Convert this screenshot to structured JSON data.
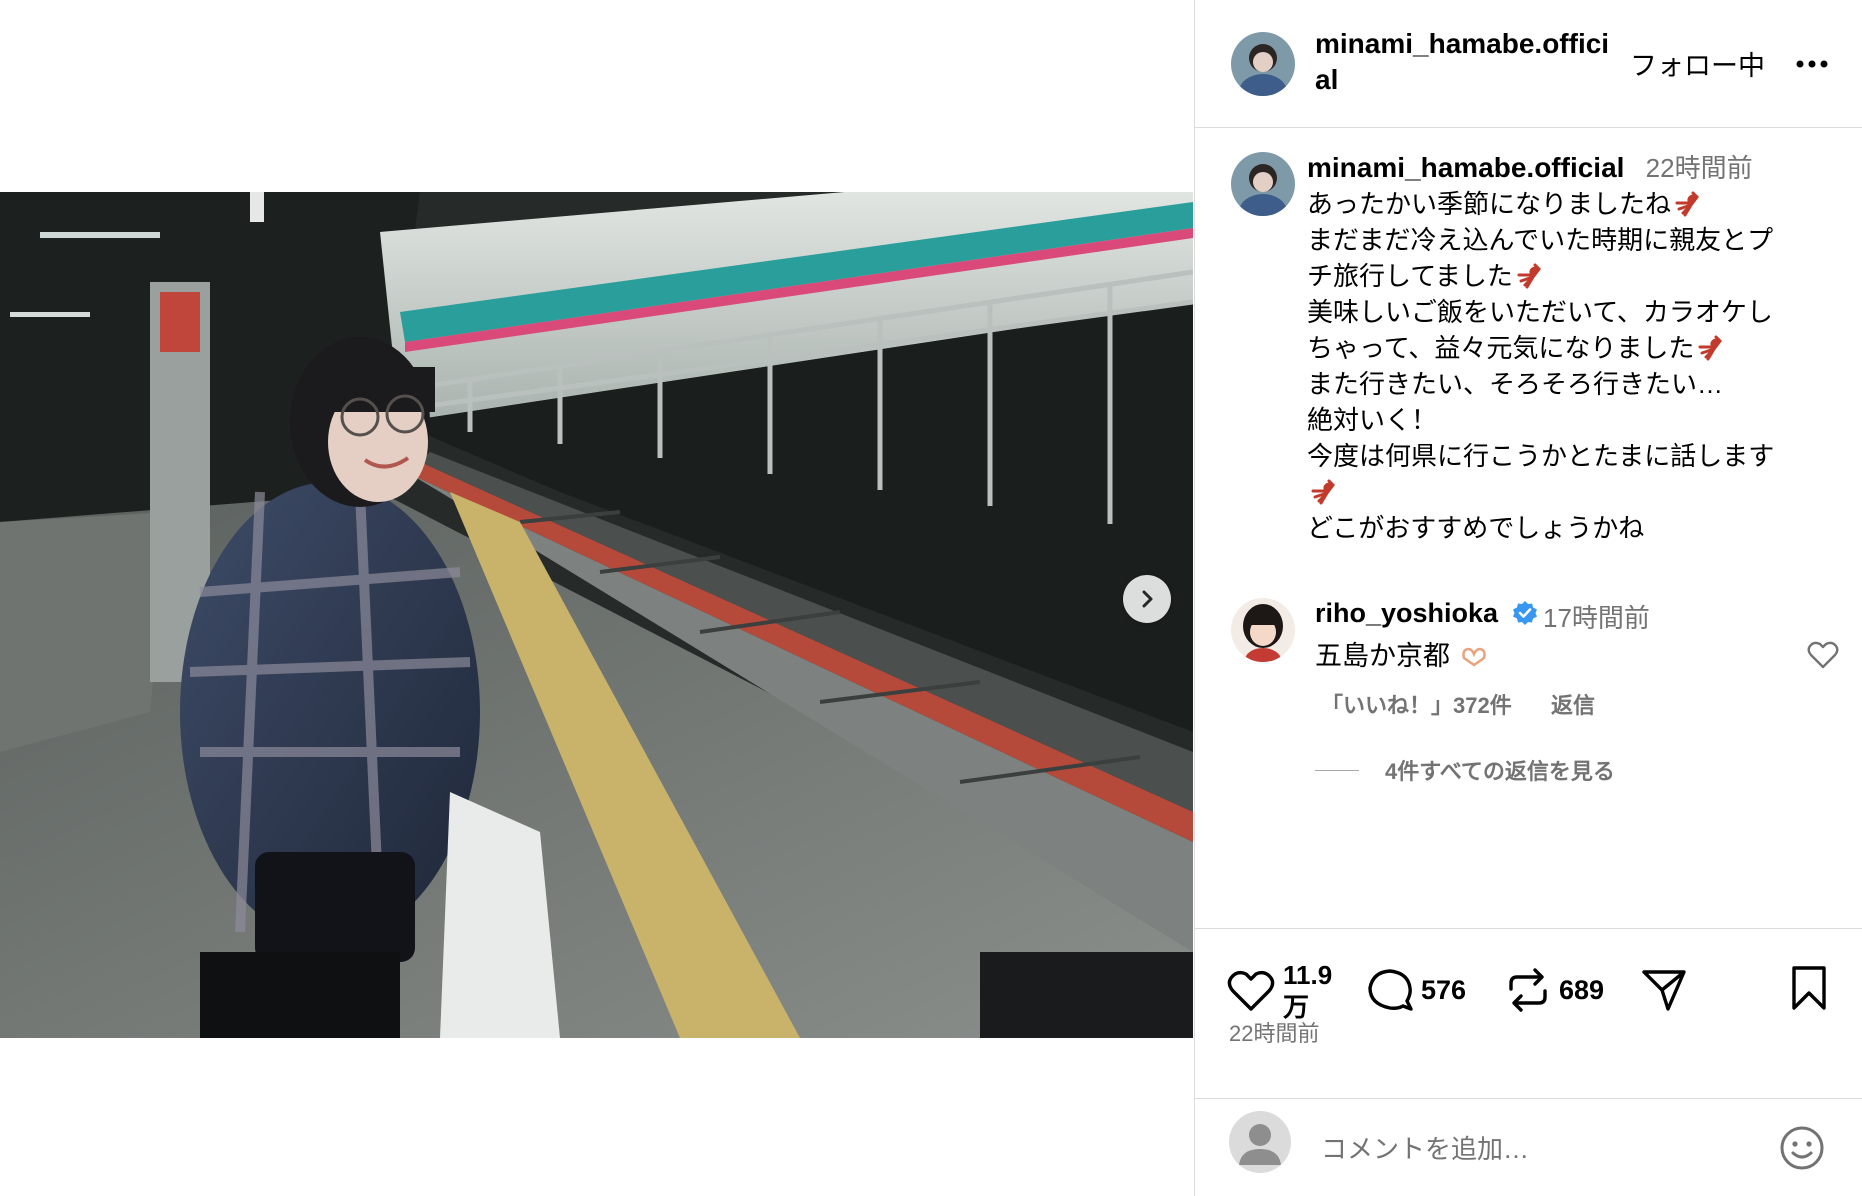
{
  "post": {
    "username": "minami_hamabe.official",
    "follow_status": "フォロー中",
    "more_label": "•••",
    "caption": {
      "time": "22時間前",
      "lines": [
        "あったかい季節になりましたね",
        "まだまだ冷え込んでいた時期に親友とプ",
        "チ旅行してました",
        "美味しいご飯をいただいて、カラオケし",
        "ちゃって、益々元気になりました",
        "また行きたい、そろそろ行きたい…",
        "絶対いく！",
        "今度は何県に行こうかとたまに話します",
        "",
        "どこがおすすめでしょうかね"
      ],
      "emoji_lines": [
        0,
        2,
        4,
        8
      ]
    },
    "comments": [
      {
        "username": "riho_yoshioka",
        "verified": true,
        "time": "17時間前",
        "text": "五島か京都",
        "likes_label": "「いいね！」372件",
        "reply_label": "返信",
        "view_replies_label": "4件すべての返信を見る"
      }
    ],
    "stats": {
      "likes": "11.9万",
      "likes_line1": "11.9",
      "likes_line2": "万",
      "comments": "576",
      "reposts": "689"
    },
    "post_time": "22時間前",
    "comment_placeholder": "コメントを追加…"
  },
  "icons": {
    "next": "chevron-right-icon",
    "like": "heart-icon",
    "comment": "speech-bubble-icon",
    "repost": "repost-icon",
    "share": "paper-plane-icon",
    "save": "bookmark-icon",
    "emoji": "smiley-icon"
  },
  "colors": {
    "verified": "#3897f0",
    "muted_text": "#737373",
    "divider": "#dbdbdb",
    "emoji_fill": "#c23a2b"
  }
}
